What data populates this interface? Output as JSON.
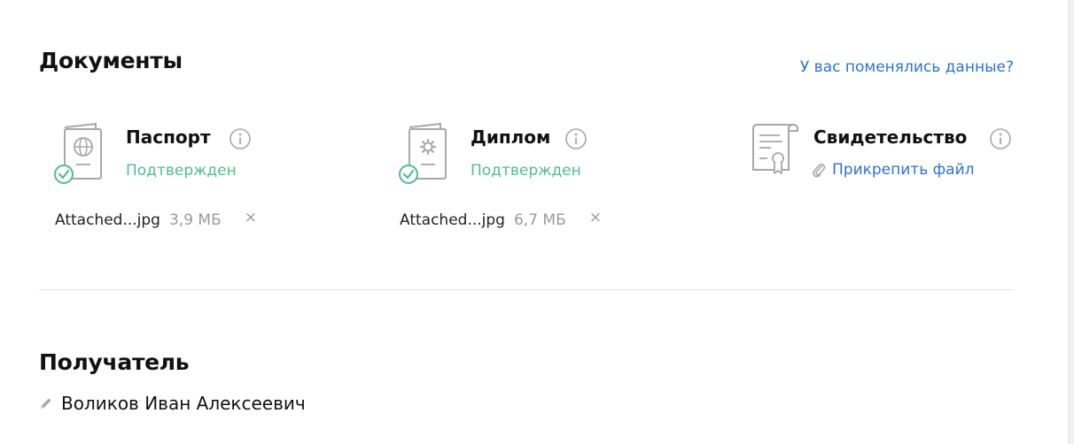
{
  "documents": {
    "title": "Документы",
    "changed_link": "У вас поменялись данные?",
    "items": [
      {
        "name": "Паспорт",
        "status": "Подтвержден",
        "file": {
          "name": "Attached...jpg",
          "size": "3,9 МБ",
          "remove": "×"
        }
      },
      {
        "name": "Диплом",
        "status": "Подтвержден",
        "file": {
          "name": "Attached...jpg",
          "size": "6,7 МБ",
          "remove": "×"
        }
      },
      {
        "name": "Свидетельство",
        "attach_label": "Прикрепить файл"
      }
    ]
  },
  "recipient": {
    "title": "Получатель",
    "name": "Воликов Иван Алексеевич"
  },
  "colors": {
    "accent_link": "#2b73d6",
    "status_confirmed": "#4dbf8e",
    "icon_gray": "#a8a8a8",
    "muted_text": "#9a9a9a"
  },
  "icons": {
    "passport": "passport-globe-icon",
    "diploma": "diploma-gear-icon",
    "certificate": "certificate-seal-icon",
    "verified": "check-circle-icon",
    "info": "info-circle-icon",
    "attach": "paperclip-icon",
    "edit": "pencil-icon",
    "remove": "close-icon"
  }
}
